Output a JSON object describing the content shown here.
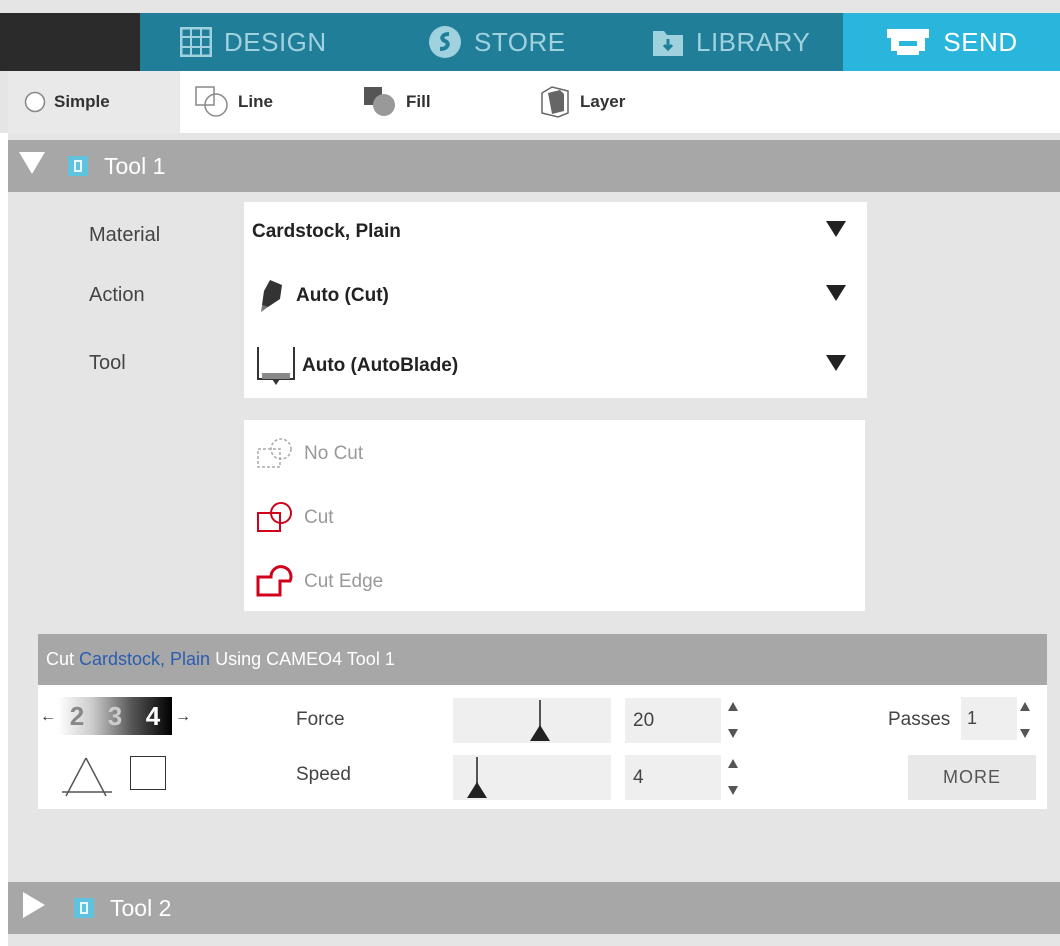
{
  "nav": {
    "tabs": [
      {
        "label": "DESIGN",
        "icon": "grid-icon"
      },
      {
        "label": "STORE",
        "icon": "store-icon"
      },
      {
        "label": "LIBRARY",
        "icon": "library-icon"
      },
      {
        "label": "SEND",
        "icon": "send-icon",
        "active": true
      }
    ]
  },
  "subtabs": [
    {
      "label": "Simple",
      "icon": "radio-icon",
      "active": true
    },
    {
      "label": "Line",
      "icon": "line-mode-icon"
    },
    {
      "label": "Fill",
      "icon": "fill-mode-icon"
    },
    {
      "label": "Layer",
      "icon": "layer-mode-icon"
    }
  ],
  "tool1": {
    "title": "Tool 1",
    "labels": {
      "material": "Material",
      "action": "Action",
      "tool": "Tool"
    },
    "material": "Cardstock, Plain",
    "action": "Auto (Cut)",
    "tool": "Auto (AutoBlade)",
    "line_options": [
      "No Cut",
      "Cut",
      "Cut Edge"
    ],
    "settings": {
      "header_prefix": "Cut",
      "header_material": "Cardstock, Plain",
      "header_suffix": "Using CAMEO4 Tool 1",
      "strip_numbers": [
        "2",
        "3",
        "4"
      ],
      "force_label": "Force",
      "force_value": "20",
      "force_level": 0.55,
      "speed_label": "Speed",
      "speed_value": "4",
      "speed_level": 0.15,
      "passes_label": "Passes",
      "passes_value": "1",
      "more_label": "MORE"
    }
  },
  "tool2": {
    "title": "Tool 2"
  },
  "colors": {
    "accent": "#2ab6dc",
    "nav_bg": "#217e98",
    "cut_red": "#d0021b",
    "link_blue": "#2a5db0"
  }
}
